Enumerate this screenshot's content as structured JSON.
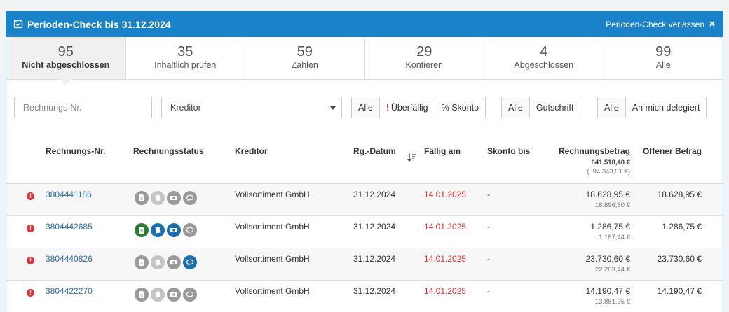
{
  "header": {
    "title": "Perioden-Check bis 31.12.2024",
    "exit_label": "Perioden-Check verlassen"
  },
  "tabs": [
    {
      "count": "95",
      "label": "Nicht abgeschlossen",
      "active": true
    },
    {
      "count": "35",
      "label": "Inhaltlich prüfen"
    },
    {
      "count": "59",
      "label": "Zahlen"
    },
    {
      "count": "29",
      "label": "Kontieren"
    },
    {
      "count": "4",
      "label": "Abgeschlossen"
    },
    {
      "count": "99",
      "label": "Alle"
    }
  ],
  "filters": {
    "invoice_placeholder": "Rechnungs-Nr.",
    "creditor_value": "Kreditor",
    "group1": [
      "Alle",
      "Überfällig",
      "% Skonto"
    ],
    "group1_overdue_mark": "!",
    "group2": [
      "Alle",
      "Gutschrift"
    ],
    "group3": [
      "Alle",
      "An mich delegiert"
    ]
  },
  "columns": {
    "invoice_no": "Rechnungs-Nr.",
    "status": "Rechnungsstatus",
    "creditor": "Kreditor",
    "invoice_date": "Rg.-Datum",
    "due": "Fällig am",
    "discount_until": "Skonto bis",
    "amount": "Rechnungsbetrag",
    "amount_total": "641.518,40 €",
    "amount_total_sub": "(594.343,51 €)",
    "open": "Offener Betrag"
  },
  "rows": [
    {
      "invoice_no": "3804441186",
      "creditor": "Vollsortiment GmbH",
      "date": "31.12.2024",
      "due": "14.01.2025",
      "discount": "-",
      "amount": "18.628,95 €",
      "amount_sub": "16.896,60 €",
      "open": "18.628,95 €"
    },
    {
      "invoice_no": "3804442685",
      "creditor": "Vollsortiment GmbH",
      "date": "31.12.2024",
      "due": "14.01.2025",
      "discount": "-",
      "amount": "1.286,75 €",
      "amount_sub": "1.187,44 €",
      "open": "1.286,75 €"
    },
    {
      "invoice_no": "3804440826",
      "creditor": "Vollsortiment GmbH",
      "date": "31.12.2024",
      "due": "14.01.2025",
      "discount": "-",
      "amount": "23.730,60 €",
      "amount_sub": "22.203,44 €",
      "open": "23.730,60 €"
    },
    {
      "invoice_no": "3804422270",
      "creditor": "Vollsortiment GmbH",
      "date": "31.12.2024",
      "due": "14.01.2025",
      "discount": "-",
      "amount": "14.190,47 €",
      "amount_sub": "13.881,35 €",
      "open": "14.190,47 €"
    }
  ],
  "colors": {
    "brand": "#1a82c8",
    "overdue": "#e03030",
    "link": "#2b6cb0"
  }
}
